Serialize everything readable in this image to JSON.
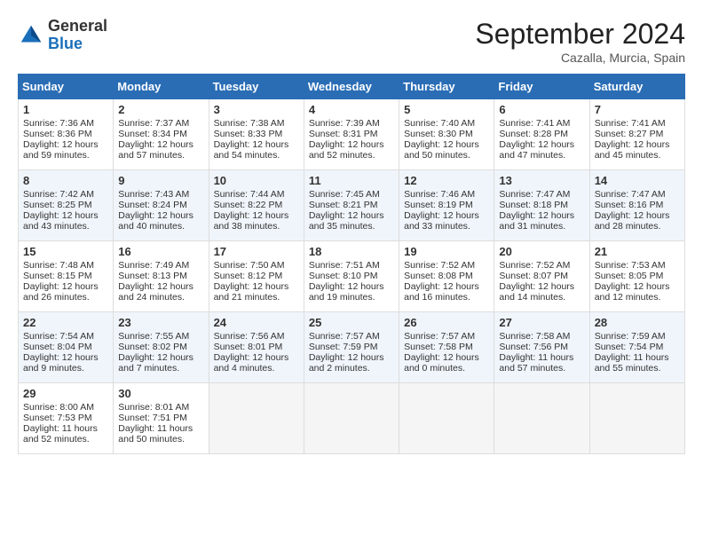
{
  "header": {
    "logo_general": "General",
    "logo_blue": "Blue",
    "month_title": "September 2024",
    "location": "Cazalla, Murcia, Spain"
  },
  "calendar": {
    "days_of_week": [
      "Sunday",
      "Monday",
      "Tuesday",
      "Wednesday",
      "Thursday",
      "Friday",
      "Saturday"
    ],
    "weeks": [
      [
        null,
        {
          "day": "2",
          "sunrise": "Sunrise: 7:37 AM",
          "sunset": "Sunset: 8:34 PM",
          "daylight": "Daylight: 12 hours and 57 minutes."
        },
        {
          "day": "3",
          "sunrise": "Sunrise: 7:38 AM",
          "sunset": "Sunset: 8:33 PM",
          "daylight": "Daylight: 12 hours and 54 minutes."
        },
        {
          "day": "4",
          "sunrise": "Sunrise: 7:39 AM",
          "sunset": "Sunset: 8:31 PM",
          "daylight": "Daylight: 12 hours and 52 minutes."
        },
        {
          "day": "5",
          "sunrise": "Sunrise: 7:40 AM",
          "sunset": "Sunset: 8:30 PM",
          "daylight": "Daylight: 12 hours and 50 minutes."
        },
        {
          "day": "6",
          "sunrise": "Sunrise: 7:41 AM",
          "sunset": "Sunset: 8:28 PM",
          "daylight": "Daylight: 12 hours and 47 minutes."
        },
        {
          "day": "7",
          "sunrise": "Sunrise: 7:41 AM",
          "sunset": "Sunset: 8:27 PM",
          "daylight": "Daylight: 12 hours and 45 minutes."
        }
      ],
      [
        {
          "day": "1",
          "sunrise": "Sunrise: 7:36 AM",
          "sunset": "Sunset: 8:36 PM",
          "daylight": "Daylight: 12 hours and 59 minutes."
        },
        null,
        null,
        null,
        null,
        null,
        null
      ],
      [
        {
          "day": "8",
          "sunrise": "Sunrise: 7:42 AM",
          "sunset": "Sunset: 8:25 PM",
          "daylight": "Daylight: 12 hours and 43 minutes."
        },
        {
          "day": "9",
          "sunrise": "Sunrise: 7:43 AM",
          "sunset": "Sunset: 8:24 PM",
          "daylight": "Daylight: 12 hours and 40 minutes."
        },
        {
          "day": "10",
          "sunrise": "Sunrise: 7:44 AM",
          "sunset": "Sunset: 8:22 PM",
          "daylight": "Daylight: 12 hours and 38 minutes."
        },
        {
          "day": "11",
          "sunrise": "Sunrise: 7:45 AM",
          "sunset": "Sunset: 8:21 PM",
          "daylight": "Daylight: 12 hours and 35 minutes."
        },
        {
          "day": "12",
          "sunrise": "Sunrise: 7:46 AM",
          "sunset": "Sunset: 8:19 PM",
          "daylight": "Daylight: 12 hours and 33 minutes."
        },
        {
          "day": "13",
          "sunrise": "Sunrise: 7:47 AM",
          "sunset": "Sunset: 8:18 PM",
          "daylight": "Daylight: 12 hours and 31 minutes."
        },
        {
          "day": "14",
          "sunrise": "Sunrise: 7:47 AM",
          "sunset": "Sunset: 8:16 PM",
          "daylight": "Daylight: 12 hours and 28 minutes."
        }
      ],
      [
        {
          "day": "15",
          "sunrise": "Sunrise: 7:48 AM",
          "sunset": "Sunset: 8:15 PM",
          "daylight": "Daylight: 12 hours and 26 minutes."
        },
        {
          "day": "16",
          "sunrise": "Sunrise: 7:49 AM",
          "sunset": "Sunset: 8:13 PM",
          "daylight": "Daylight: 12 hours and 24 minutes."
        },
        {
          "day": "17",
          "sunrise": "Sunrise: 7:50 AM",
          "sunset": "Sunset: 8:12 PM",
          "daylight": "Daylight: 12 hours and 21 minutes."
        },
        {
          "day": "18",
          "sunrise": "Sunrise: 7:51 AM",
          "sunset": "Sunset: 8:10 PM",
          "daylight": "Daylight: 12 hours and 19 minutes."
        },
        {
          "day": "19",
          "sunrise": "Sunrise: 7:52 AM",
          "sunset": "Sunset: 8:08 PM",
          "daylight": "Daylight: 12 hours and 16 minutes."
        },
        {
          "day": "20",
          "sunrise": "Sunrise: 7:52 AM",
          "sunset": "Sunset: 8:07 PM",
          "daylight": "Daylight: 12 hours and 14 minutes."
        },
        {
          "day": "21",
          "sunrise": "Sunrise: 7:53 AM",
          "sunset": "Sunset: 8:05 PM",
          "daylight": "Daylight: 12 hours and 12 minutes."
        }
      ],
      [
        {
          "day": "22",
          "sunrise": "Sunrise: 7:54 AM",
          "sunset": "Sunset: 8:04 PM",
          "daylight": "Daylight: 12 hours and 9 minutes."
        },
        {
          "day": "23",
          "sunrise": "Sunrise: 7:55 AM",
          "sunset": "Sunset: 8:02 PM",
          "daylight": "Daylight: 12 hours and 7 minutes."
        },
        {
          "day": "24",
          "sunrise": "Sunrise: 7:56 AM",
          "sunset": "Sunset: 8:01 PM",
          "daylight": "Daylight: 12 hours and 4 minutes."
        },
        {
          "day": "25",
          "sunrise": "Sunrise: 7:57 AM",
          "sunset": "Sunset: 7:59 PM",
          "daylight": "Daylight: 12 hours and 2 minutes."
        },
        {
          "day": "26",
          "sunrise": "Sunrise: 7:57 AM",
          "sunset": "Sunset: 7:58 PM",
          "daylight": "Daylight: 12 hours and 0 minutes."
        },
        {
          "day": "27",
          "sunrise": "Sunrise: 7:58 AM",
          "sunset": "Sunset: 7:56 PM",
          "daylight": "Daylight: 11 hours and 57 minutes."
        },
        {
          "day": "28",
          "sunrise": "Sunrise: 7:59 AM",
          "sunset": "Sunset: 7:54 PM",
          "daylight": "Daylight: 11 hours and 55 minutes."
        }
      ],
      [
        {
          "day": "29",
          "sunrise": "Sunrise: 8:00 AM",
          "sunset": "Sunset: 7:53 PM",
          "daylight": "Daylight: 11 hours and 52 minutes."
        },
        {
          "day": "30",
          "sunrise": "Sunrise: 8:01 AM",
          "sunset": "Sunset: 7:51 PM",
          "daylight": "Daylight: 11 hours and 50 minutes."
        },
        null,
        null,
        null,
        null,
        null
      ]
    ]
  }
}
